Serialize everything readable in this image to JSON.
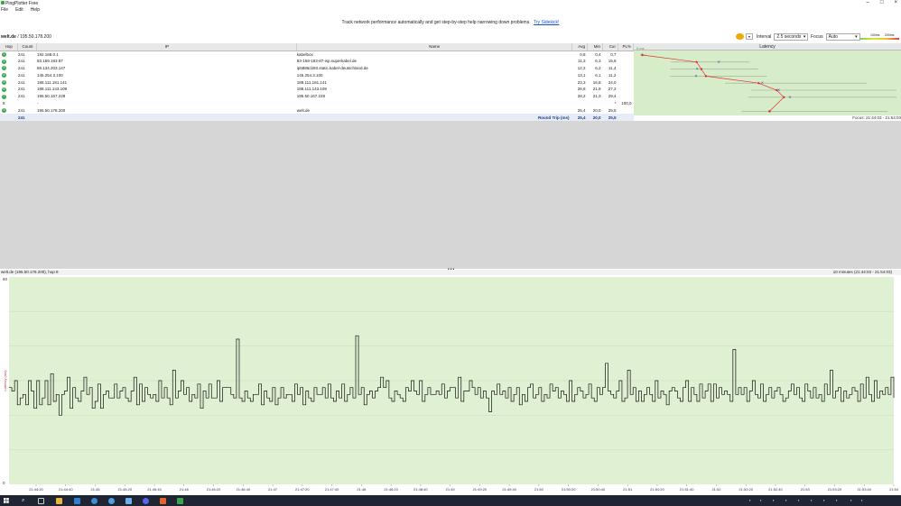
{
  "window": {
    "title": "PingPlotter Free"
  },
  "menu": [
    "File",
    "Edit",
    "Help"
  ],
  "banner": {
    "text": "Track network performance automatically and get step-by-step help narrowing down problems.",
    "link": "Try Sidekick!"
  },
  "target": {
    "name": "welt.de",
    "sep": " / ",
    "ip": "195.50.178.200"
  },
  "controls": {
    "interval_label": "Interval",
    "interval_value": "2.5 seconds",
    "focus_label": "Focus",
    "focus_value": "Auto",
    "scale_200": "100ms",
    "scale_500": "200ms"
  },
  "columns": {
    "hop": "Hop",
    "count": "Count",
    "ip": "IP",
    "name": "Name",
    "avg": "Avg",
    "min": "Min",
    "cur": "Cur",
    "pl": "PL%",
    "latency": "Latency"
  },
  "rows": [
    {
      "hop": "1",
      "count": "241",
      "ip": "192.168.0.1",
      "name": "kabelbox",
      "avg": "0,8",
      "min": "0,4",
      "cur": "0,7",
      "pl": ""
    },
    {
      "hop": "2",
      "count": "241",
      "ip": "83.169.183.87",
      "name": "83-169-183-87-isp.superkabel.de",
      "avg": "11,3",
      "min": "6,3",
      "cur": "15,6",
      "pl": ""
    },
    {
      "hop": "3",
      "count": "241",
      "ip": "88.134.203.147",
      "name": "ip5886cb93.static.kabel-deutschland.de",
      "avg": "12,2",
      "min": "6,2",
      "cur": "11,4",
      "pl": ""
    },
    {
      "hop": "4",
      "count": "241",
      "ip": "145.254.3.100",
      "name": "145.254.3.100",
      "avg": "13,1",
      "min": "6,1",
      "cur": "11,2",
      "pl": ""
    },
    {
      "hop": "5",
      "count": "241",
      "ip": "188.111.181.141",
      "name": "188.111.181.141",
      "avg": "23,3",
      "min": "16,8",
      "cur": "24,0",
      "pl": ""
    },
    {
      "hop": "6",
      "count": "241",
      "ip": "188.111.143.109",
      "name": "188.111.143.109",
      "avg": "26,8",
      "min": "21,9",
      "cur": "27,2",
      "pl": ""
    },
    {
      "hop": "7",
      "count": "241",
      "ip": "195.50.167.228",
      "name": "195.50.167.228",
      "avg": "28,2",
      "min": "21,3",
      "cur": "29,4",
      "pl": ""
    },
    {
      "hop": "8",
      "count": "",
      "ip": "-",
      "name": "",
      "avg": "",
      "min": "",
      "cur": "*",
      "pl": "100,0"
    },
    {
      "hop": "9",
      "count": "241",
      "ip": "195.50.178.200",
      "name": "welt.de",
      "avg": "25,4",
      "min": "20,0",
      "cur": "25,5",
      "pl": ""
    }
  ],
  "summary": {
    "count": "241",
    "label": "Round Trip (ms)",
    "avg": "25,4",
    "min": "20,0",
    "cur": "25,5",
    "focus": "Focus: 21:44:03 - 21:54:03"
  },
  "latency_zero": "0 ms",
  "graph": {
    "header_left": "welt.de (195.50.178.200), hop 9",
    "header_right": "10 minutes (21:44:03 - 21:54:03)",
    "ytop": "60",
    "ybottom": "0",
    "ylabel": "Latency (ms)",
    "time_labels": [
      "21:44:20",
      "21:44:40",
      "21:45",
      "21:45:20",
      "21:45:40",
      "21:46",
      "21:46:20",
      "21:46:40",
      "21:47",
      "21:47:20",
      "21:47:40",
      "21:48",
      "21:48:20",
      "21:48:40",
      "21:49",
      "21:49:20",
      "21:49:40",
      "21:50",
      "21:50:20",
      "21:50:40",
      "21:51",
      "21:51:20",
      "21:51:40",
      "21:52",
      "21:52:20",
      "21:52:40",
      "21:53",
      "21:53:20",
      "21:53:40",
      "21:54"
    ]
  },
  "chart_data": {
    "type": "line",
    "ylim": [
      0,
      60
    ],
    "ylabel": "Latency (ms)",
    "series": [
      {
        "values": [
          28,
          27,
          30,
          23,
          25,
          26,
          23,
          30,
          27,
          22,
          30,
          23,
          25,
          30,
          23,
          32,
          24,
          26,
          20,
          26,
          27,
          31,
          22,
          28,
          25,
          24,
          27,
          31,
          26,
          28,
          22,
          24,
          29,
          22,
          26,
          27,
          25,
          25,
          29,
          25,
          27,
          28,
          25,
          24,
          27,
          31,
          23,
          29,
          24,
          28,
          26,
          25,
          26,
          24,
          30,
          25,
          28,
          25,
          23,
          33,
          25,
          27,
          30,
          26,
          28,
          24,
          26,
          25,
          29,
          22,
          27,
          25,
          29,
          25,
          25,
          30,
          24,
          28,
          28,
          28,
          26,
          25,
          42,
          25,
          24,
          27,
          25,
          24,
          26,
          26,
          29,
          23,
          27,
          25,
          24,
          28,
          23,
          25,
          28,
          25,
          26,
          26,
          24,
          29,
          26,
          28,
          23,
          27,
          25,
          24,
          28,
          26,
          26,
          28,
          25,
          29,
          25,
          24,
          27,
          25,
          29,
          24,
          26,
          28,
          25,
          43,
          26,
          28,
          23,
          26,
          27,
          25,
          27,
          28,
          31,
          28,
          30,
          25,
          24,
          27,
          26,
          25,
          24,
          28,
          27,
          30,
          27,
          26,
          30,
          24,
          26,
          28,
          26,
          26,
          27,
          26,
          29,
          25,
          27,
          28,
          28,
          25,
          31,
          24,
          27,
          27,
          30,
          28,
          26,
          28,
          25,
          27,
          25,
          21,
          27,
          26,
          29,
          26,
          27,
          25,
          28,
          24,
          26,
          28,
          23,
          26,
          24,
          28,
          29,
          25,
          26,
          28,
          24,
          26,
          25,
          29,
          27,
          28,
          25,
          27,
          26,
          24,
          30,
          24,
          26,
          28,
          27,
          25,
          26,
          29,
          25,
          24,
          28,
          26,
          28,
          35,
          27,
          26,
          25,
          27,
          30,
          24,
          25,
          33,
          26,
          28,
          24,
          27,
          24,
          26,
          28,
          26,
          24,
          30,
          25,
          27,
          26,
          23,
          27,
          28,
          27,
          25,
          24,
          28,
          30,
          24,
          28,
          26,
          24,
          29,
          25,
          27,
          29,
          24,
          29,
          25,
          28,
          26,
          27,
          26,
          24,
          39,
          26,
          28,
          26,
          28,
          24,
          27,
          30,
          26,
          25,
          29,
          24,
          26,
          28,
          25,
          27,
          28,
          26,
          24,
          25,
          27,
          29,
          26,
          28,
          25,
          24,
          29,
          27,
          25,
          28,
          25,
          26,
          24,
          29,
          26,
          33,
          25,
          27,
          28,
          24,
          27,
          25,
          26,
          28,
          27,
          24,
          29,
          25,
          31,
          26,
          24,
          30,
          25,
          27,
          26,
          28,
          26,
          31,
          25
        ]
      }
    ]
  }
}
